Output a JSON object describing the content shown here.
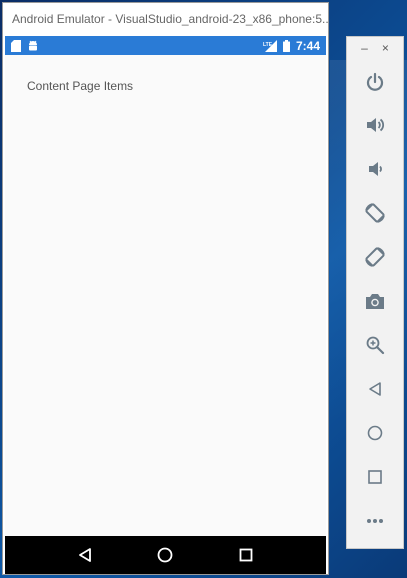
{
  "window": {
    "title": "Android Emulator - VisualStudio_android-23_x86_phone:5..."
  },
  "status_bar": {
    "left_icons": [
      "sd-card-icon",
      "android-icon"
    ],
    "right_icons": [
      "lte-signal-icon",
      "battery-icon"
    ],
    "network_label": "LTE",
    "time": "7:44",
    "color": "#2a7bd6"
  },
  "app": {
    "page_text": "Content Page Items"
  },
  "nav_bar": {
    "buttons": [
      "back-icon",
      "home-icon",
      "recents-icon"
    ]
  },
  "toolbar": {
    "window_controls": {
      "minimize": "–",
      "close": "×"
    },
    "buttons": [
      "power-icon",
      "volume-up-icon",
      "volume-down-icon",
      "rotate-left-icon",
      "rotate-right-icon",
      "camera-icon",
      "zoom-icon",
      "back-icon",
      "home-icon",
      "recents-icon",
      "more-icon"
    ],
    "icon_color": "#6b7b88"
  }
}
